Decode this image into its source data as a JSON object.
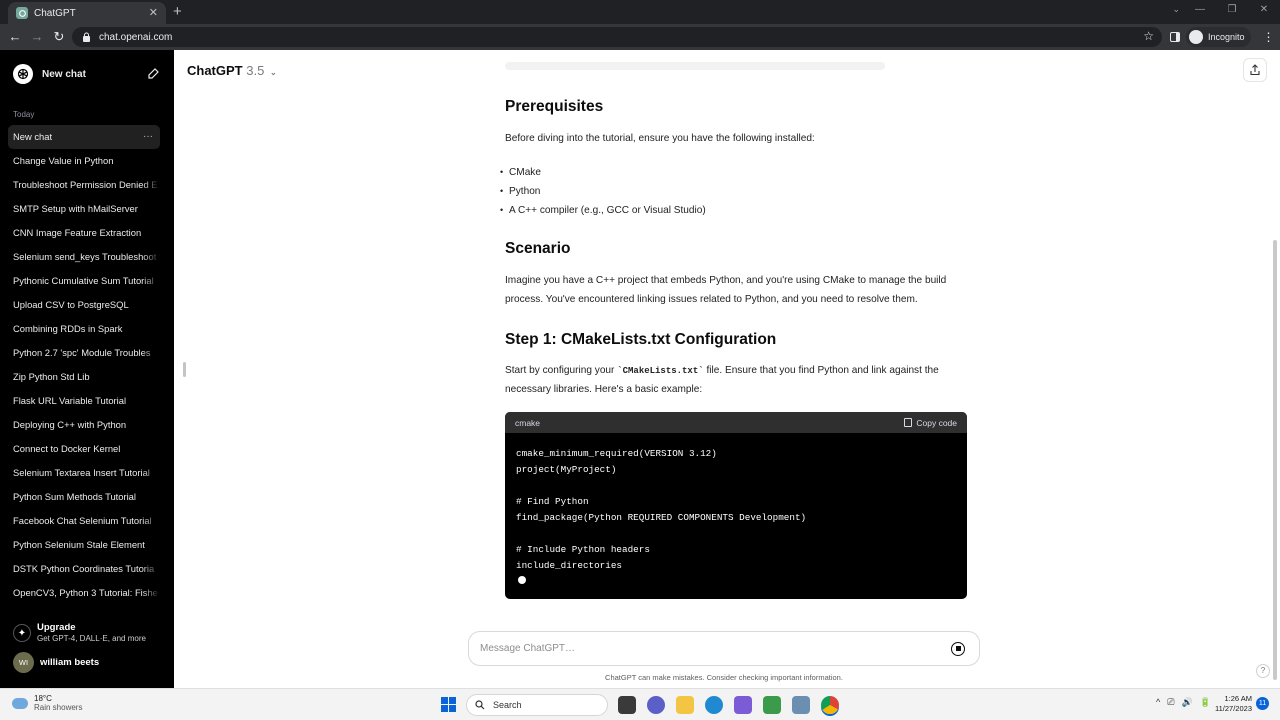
{
  "browser": {
    "tab_title": "ChatGPT",
    "tab_close": "✕",
    "new_tab": "+",
    "url": "chat.openai.com",
    "back": "←",
    "forward": "→",
    "reload": "↻",
    "profile_label": "Incognito",
    "window_controls": [
      "—",
      "❐",
      "✕"
    ],
    "tab_dropdown": "⌄"
  },
  "sidebar": {
    "new_chat_label": "New chat",
    "section_today": "Today",
    "history": [
      "New chat",
      "Change Value in Python",
      "Troubleshoot Permission Denied E",
      "SMTP Setup with hMailServer",
      "CNN Image Feature Extraction",
      "Selenium send_keys Troubleshoot",
      "Pythonic Cumulative Sum Tutorial",
      "Upload CSV to PostgreSQL",
      "Combining RDDs in Spark",
      "Python 2.7 'spc' Module Troubles",
      "Zip Python Std Lib",
      "Flask URL Variable Tutorial",
      "Deploying C++ with Python",
      "Connect to Docker Kernel",
      "Selenium Textarea Insert Tutorial",
      "Python Sum Methods Tutorial",
      "Facebook Chat Selenium Tutorial",
      "Python Selenium Stale Element",
      "DSTK Python Coordinates Tutoria",
      "OpenCV3, Python 3 Tutorial: Fishe"
    ],
    "active_dots": "···",
    "upgrade_title": "Upgrade",
    "upgrade_sub": "Get GPT-4, DALL·E, and more",
    "user_initials": "WI",
    "user_name": "william beets"
  },
  "header": {
    "model_name": "ChatGPT",
    "model_version": "3.5",
    "chevron": "⌄"
  },
  "content": {
    "prereq_heading": "Prerequisites",
    "prereq_intro": "Before diving into the tutorial, ensure you have the following installed:",
    "prereq_items": [
      "CMake",
      "Python",
      "A C++ compiler (e.g., GCC or Visual Studio)"
    ],
    "scenario_heading": "Scenario",
    "scenario_line1": "Imagine you have a C++ project that embeds Python, and you're using CMake to manage the build",
    "scenario_line2": "process. You've encountered linking issues related to Python, and you need to resolve them.",
    "step1_heading": "Step 1: CMakeLists.txt Configuration",
    "step1_pre": "Start by configuring your ",
    "step1_code": "`CMakeLists.txt`",
    "step1_post": " file. Ensure that you find Python and link against the",
    "step1_line2": "necessary libraries. Here's a basic example:"
  },
  "codeblock": {
    "language": "cmake",
    "copy_label": "Copy code",
    "lines": [
      "cmake_minimum_required(VERSION 3.12)",
      "project(MyProject)",
      "",
      "# Find Python",
      "find_package(Python REQUIRED COMPONENTS Development)",
      "",
      "# Include Python headers",
      "include_directories"
    ]
  },
  "composer": {
    "placeholder": "Message ChatGPT…",
    "disclaimer": "ChatGPT can make mistakes. Consider checking important information.",
    "help": "?"
  },
  "taskbar": {
    "temperature": "18°C",
    "weather": "Rain showers",
    "search_label": "Search",
    "time": "1:26 AM",
    "date": "11/27/2023",
    "notifications": "11",
    "tray_icons": [
      "^",
      "⎚",
      "🔊",
      "🔋"
    ]
  },
  "colors": {
    "sidebar_bg": "#000000",
    "code_bg": "#000000",
    "code_header_bg": "#2f2f2f",
    "accent": "#0a64d8"
  }
}
